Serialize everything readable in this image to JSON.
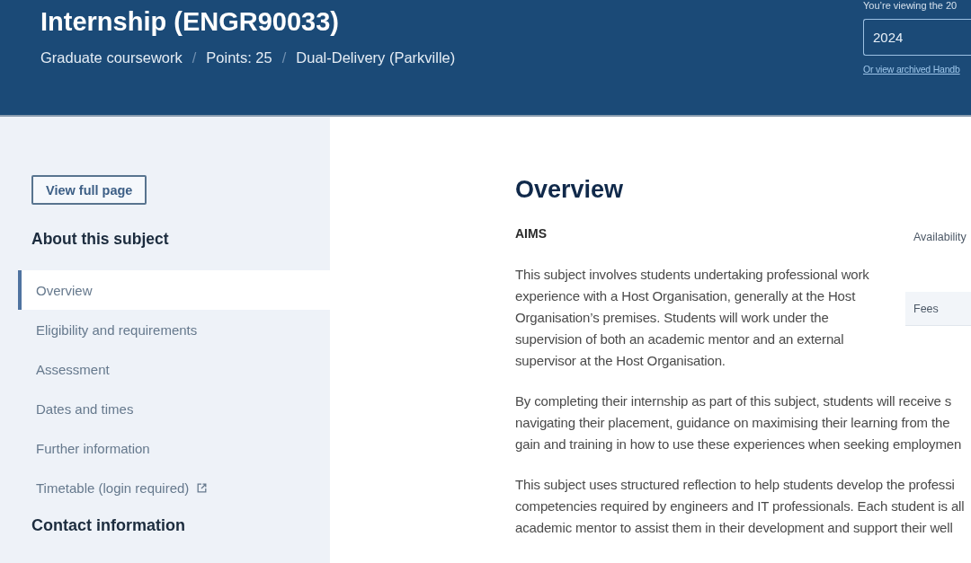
{
  "header": {
    "title": "Internship (ENGR90033)",
    "meta": [
      {
        "kind": "text",
        "text": "Graduate coursework"
      },
      {
        "kind": "separator",
        "text": "/"
      },
      {
        "kind": "text",
        "text": "Points: 25"
      },
      {
        "kind": "separator",
        "text": "/"
      },
      {
        "kind": "text",
        "text": "Dual-Delivery (Parkville)"
      }
    ],
    "year_picker": {
      "caption": "You’re viewing the 20",
      "value": "2024",
      "archive_link": "Or view archived Handb"
    }
  },
  "sidebar": {
    "button": "View full page",
    "heading": "About this subject",
    "nav": [
      {
        "label": "Overview",
        "selected": true,
        "external": false
      },
      {
        "label": "Eligibility and requirements",
        "selected": false,
        "external": false
      },
      {
        "label": "Assessment",
        "selected": false,
        "external": false
      },
      {
        "label": "Dates and times",
        "selected": false,
        "external": false
      },
      {
        "label": "Further information",
        "selected": false,
        "external": false
      },
      {
        "label": "Timetable (login required)",
        "selected": false,
        "external": true
      }
    ],
    "contact_heading": "Contact information"
  },
  "main": {
    "heading": "Overview",
    "section_label": "AIMS",
    "intro": "This subject involves students undertaking professional work experience with a Host Organisation, generally at the Host Organisation’s premises. Students will work under the supervision of both an academic mentor and an external supervisor at the Host Organisation.",
    "side_panel": [
      {
        "label": "Availability",
        "shaded": false
      },
      {
        "label": "Fees",
        "shaded": true
      }
    ],
    "paragraphs": [
      {
        "lines": [
          "By completing their internship as part of this subject, students will receive s",
          "navigating their placement, guidance on maximising their learning from the",
          "gain and training in how to use these experiences when seeking employmen"
        ]
      },
      {
        "lines": [
          "This subject uses structured reflection to help students develop the professi",
          "competencies required by engineers and IT professionals. Each student is all",
          "academic mentor to assist them in their development and support their well"
        ]
      }
    ]
  }
}
